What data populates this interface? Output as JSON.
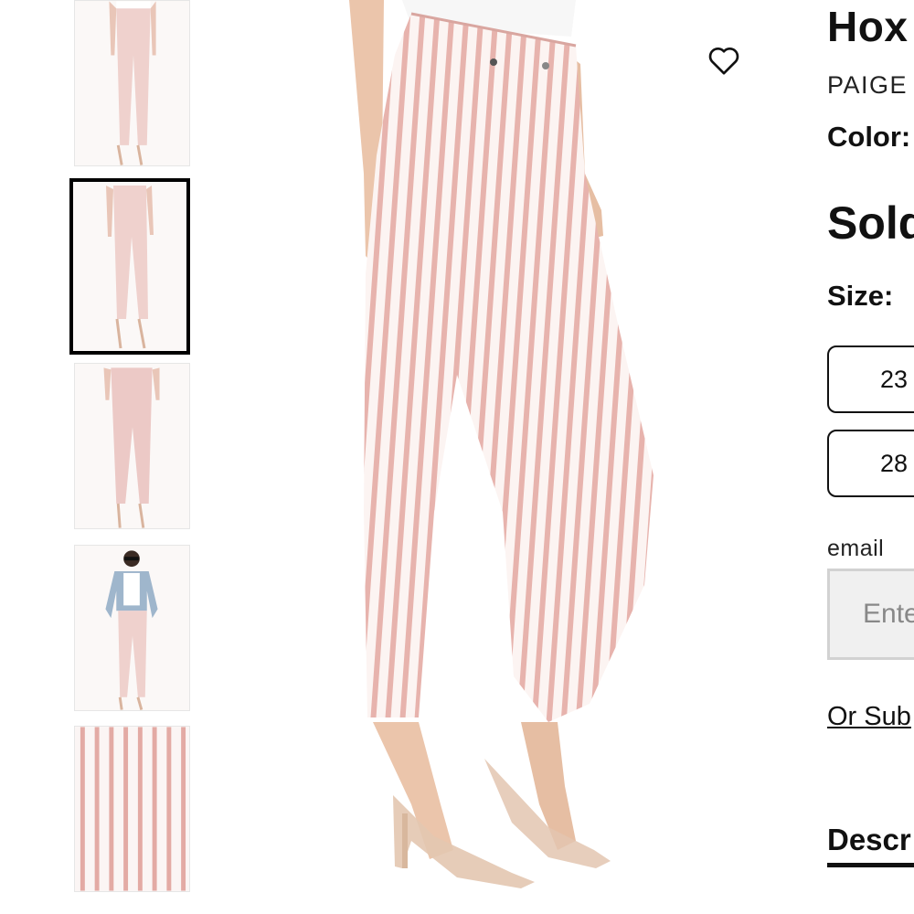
{
  "product": {
    "title": "Hox",
    "brand": "PAIGE",
    "color_label": "Color:",
    "status": "Sold",
    "size_label": "Size:",
    "sizes": [
      "23",
      "28"
    ],
    "email_label": "email",
    "email_placeholder": "Ente",
    "subscribe_link": "Or Sub",
    "description_tab": "Descr"
  },
  "gallery": {
    "thumbnails": [
      "front-full",
      "front-full-alt",
      "back-full",
      "styled-with-jacket",
      "fabric-detail"
    ],
    "selected_index": 1
  },
  "icons": {
    "wishlist": "heart-outline-icon"
  },
  "colors": {
    "stripe": "#e7b3ad",
    "text": "#111111",
    "input_bg": "#f0f0f0"
  }
}
